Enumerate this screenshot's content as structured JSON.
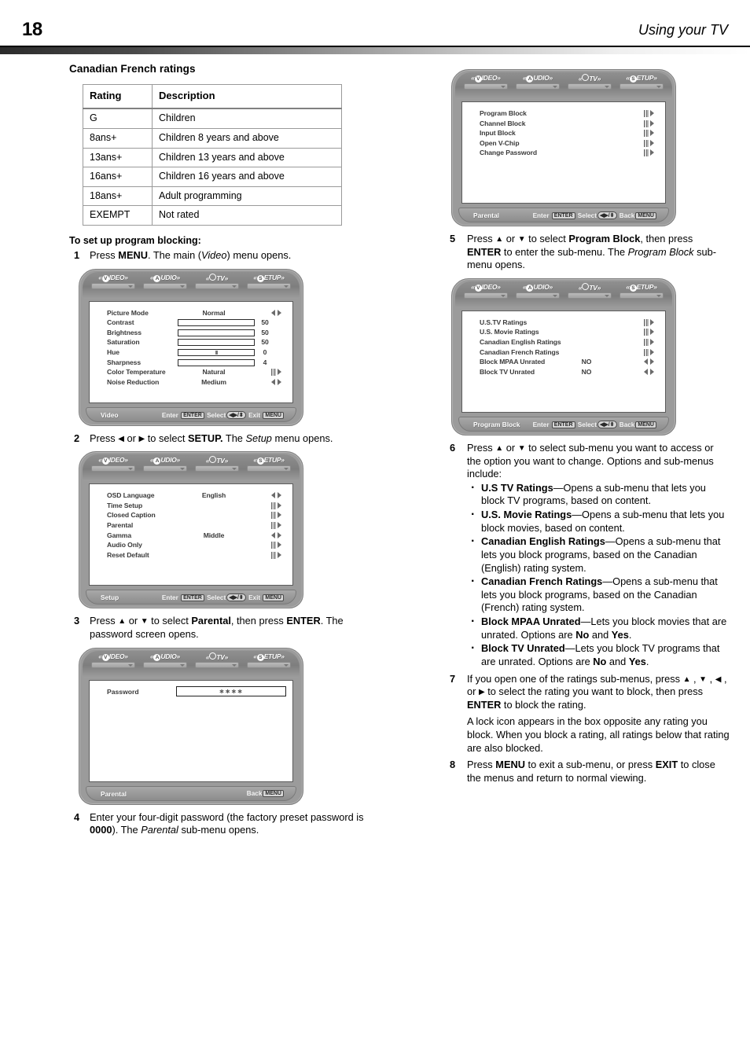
{
  "header": {
    "page_number": "18",
    "title": "Using your TV"
  },
  "left_column": {
    "section_title": "Canadian French ratings",
    "table": {
      "columns": [
        "Rating",
        "Description"
      ],
      "rows": [
        [
          "G",
          "Children"
        ],
        [
          "8ans+",
          "Children 8 years and above"
        ],
        [
          "13ans+",
          "Children 13 years and above"
        ],
        [
          "16ans+",
          "Children 16 years and above"
        ],
        [
          "18ans+",
          "Adult programming"
        ],
        [
          "EXEMPT",
          "Not rated"
        ]
      ]
    },
    "procedure_heading": "To set up program blocking:",
    "steps": [
      {
        "num": "1",
        "html": "Press <b>MENU</b>. The main (<i>Video</i>) menu opens."
      },
      {
        "num": "2",
        "html": "Press <span class=\"ar\">&#9664;</span> or <span class=\"ar\">&#9654;</span> to select <b>SETUP.</b> The <i>Setup</i> menu opens."
      },
      {
        "num": "3",
        "html": "Press <span class=\"ar\">&#9650;</span> or <span class=\"ar\">&#9660;</span> to select <b>Parental</b>, then press <b>ENTER</b>. The password screen opens."
      },
      {
        "num": "4",
        "html": "Enter your four-digit password (the factory preset password is <b>0000</b>). The <i>Parental</i> sub-menu opens."
      }
    ]
  },
  "right_column": {
    "steps": [
      {
        "num": "5",
        "html": "Press <span class=\"ar\">&#9650;</span> or <span class=\"ar\">&#9660;</span> to select <b>Program Block</b>, then press <b>ENTER</b> to enter the sub-menu. The <i>Program Block</i> sub-menu opens."
      },
      {
        "num": "6",
        "html": "Press <span class=\"ar\">&#9650;</span> or <span class=\"ar\">&#9660;</span> to select sub-menu you want to access or the option you want to change. Options and sub-menus include:"
      },
      {
        "num": "7",
        "html": "If you open one of the ratings sub-menus, press <span class=\"ar\">&#9650;</span> , <span class=\"ar\">&#9660;</span> , <span class=\"ar\">&#9664;</span> , or <span class=\"ar\">&#9654;</span> to select the rating you want to block, then press <b>ENTER</b> to block the rating."
      },
      {
        "num": "8",
        "html": "Press <b>MENU</b> to exit a sub-menu, or press <b>EXIT</b> to close the menus and return to normal viewing."
      }
    ],
    "bullets": [
      {
        "html": "<b>U.S TV Ratings</b>&#8212;Opens a sub-menu that lets you block TV programs, based on content."
      },
      {
        "html": "<b>U.S. Movie Ratings</b>&#8212;Opens a sub-menu that lets you block movies, based on content."
      },
      {
        "html": "<b>Canadian English Ratings</b>&#8212;Opens a sub-menu that lets you block programs, based on the Canadian (English) rating system."
      },
      {
        "html": "<b>Canadian French Ratings</b>&#8212;Opens a sub-menu that lets you block programs, based on the Canadian (French) rating system."
      },
      {
        "html": "<b>Block MPAA Unrated</b>&#8212;Lets you block movies that are unrated. Options are <b>No</b> and <b>Yes</b>."
      },
      {
        "html": "<b>Block TV Unrated</b>&#8212;Lets you block TV programs that are unrated. Options are <b>No</b> and <b>Yes</b>."
      }
    ],
    "note": "A lock icon appears in the box opposite any rating you block. When you block a rating, all ratings below that rating are also blocked."
  },
  "osd_common": {
    "tabs": [
      {
        "badge": "V",
        "rest": "IDEO",
        "name": "video"
      },
      {
        "badge": "A",
        "rest": "UDIO",
        "name": "audio"
      },
      {
        "badge": "",
        "rest": "TV",
        "name": "tv"
      },
      {
        "badge": "S",
        "rest": "ETUP",
        "name": "setup"
      }
    ],
    "footer_enter": "Enter",
    "footer_enter_key": "ENTER",
    "footer_select": "Select",
    "footer_select_key": "◀▶/⬍",
    "footer_exit": "Exit",
    "footer_back": "Back",
    "footer_menu_key": "MENU"
  },
  "osd_video": {
    "footer_left": "Video",
    "rows": [
      {
        "label": "Picture Mode",
        "value": "Normal",
        "indicator": "lr"
      },
      {
        "label": "Contrast",
        "number": "50",
        "slider": 72,
        "slider_color": "#9a9a9a"
      },
      {
        "label": "Brightness",
        "number": "50",
        "slider": 72,
        "slider_color": "#4e4e4e"
      },
      {
        "label": "Saturation",
        "number": "50",
        "slider": 72,
        "slider_color": "#757575"
      },
      {
        "label": "Hue",
        "number": "0",
        "slider": 0,
        "tick": 50
      },
      {
        "label": "Sharpness",
        "number": "4",
        "slider": 55,
        "slider_color": "#9a9a9a"
      },
      {
        "label": "Color Temperature",
        "value": "Natural",
        "indicator": "sub"
      },
      {
        "label": "Noise Reduction",
        "value": "Medium",
        "indicator": "lr"
      }
    ]
  },
  "osd_setup": {
    "footer_left": "Setup",
    "rows": [
      {
        "label": "OSD Language",
        "value": "English",
        "indicator": "lr"
      },
      {
        "label": "Time Setup",
        "value": "",
        "indicator": "sub"
      },
      {
        "label": "Closed Caption",
        "value": "",
        "indicator": "sub"
      },
      {
        "label": "Parental",
        "value": "",
        "indicator": "sub"
      },
      {
        "label": "Gamma",
        "value": "Middle",
        "indicator": "lr"
      },
      {
        "label": "Audio Only",
        "value": "",
        "indicator": "sub"
      },
      {
        "label": "Reset Default",
        "value": "",
        "indicator": "sub"
      }
    ]
  },
  "osd_password": {
    "footer_left": "Parental",
    "field_label": "Password",
    "field_value": "∗∗∗∗"
  },
  "osd_parental": {
    "footer_left": "Parental",
    "rows": [
      {
        "label": "Program Block",
        "value": "",
        "indicator": "sub"
      },
      {
        "label": "Channel Block",
        "value": "",
        "indicator": "sub"
      },
      {
        "label": "Input Block",
        "value": "",
        "indicator": "sub"
      },
      {
        "label": "Open V-Chip",
        "value": "",
        "indicator": "sub"
      },
      {
        "label": "Change Password",
        "value": "",
        "indicator": "sub"
      }
    ]
  },
  "osd_program_block": {
    "footer_left": "Program Block",
    "rows": [
      {
        "label": "U.S.TV Ratings",
        "value": "",
        "indicator": "sub"
      },
      {
        "label": "U.S. Movie Ratings",
        "value": "",
        "indicator": "sub"
      },
      {
        "label": "Canadian English Ratings",
        "value": "",
        "indicator": "sub"
      },
      {
        "label": "Canadian French Ratings",
        "value": "",
        "indicator": "sub"
      },
      {
        "label": "Block MPAA Unrated",
        "value": "NO",
        "indicator": "lr"
      },
      {
        "label": "Block TV Unrated",
        "value": "NO",
        "indicator": "lr"
      }
    ]
  }
}
